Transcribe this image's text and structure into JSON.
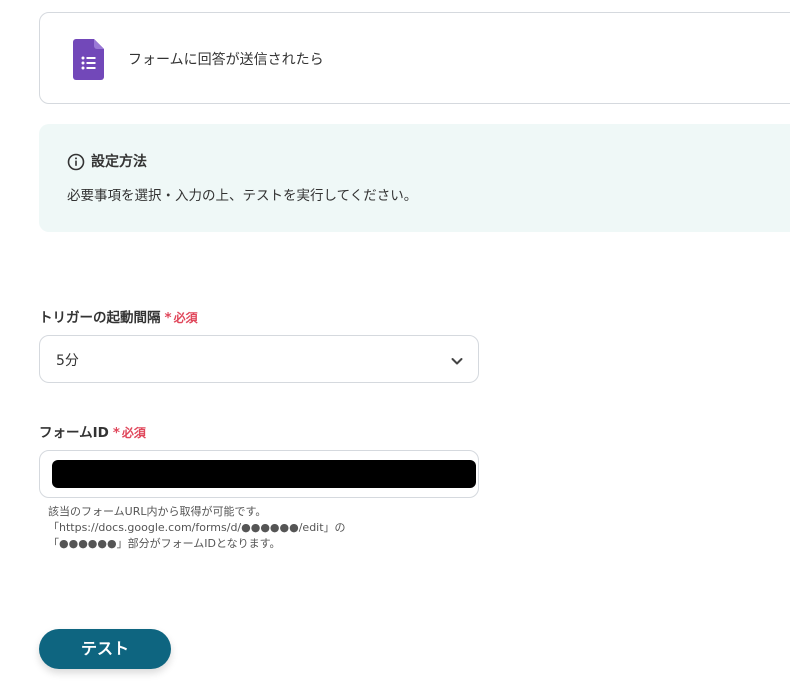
{
  "trigger": {
    "label": "フォームに回答が送信されたら",
    "icon": "google-forms-icon"
  },
  "info": {
    "title": "設定方法",
    "text": "必要事項を選択・入力の上、テストを実行してください。",
    "icon": "info-icon"
  },
  "interval_field": {
    "label": "トリガーの起動間隔",
    "required_mark": "*",
    "required_text": "必須",
    "value": "5分"
  },
  "form_id_field": {
    "label": "フォームID",
    "required_mark": "*",
    "required_text": "必須",
    "help_lines": [
      "該当のフォームURL内から取得が可能です。",
      "「https://docs.google.com/forms/d/●●●●●●/edit」の",
      "「●●●●●●」部分がフォームIDとなります。"
    ]
  },
  "test_button": {
    "label": "テスト"
  },
  "colors": {
    "accent": "#0e6580",
    "required": "#e0475b",
    "info_background": "#eff8f7",
    "forms_purple": "#7248b9"
  }
}
